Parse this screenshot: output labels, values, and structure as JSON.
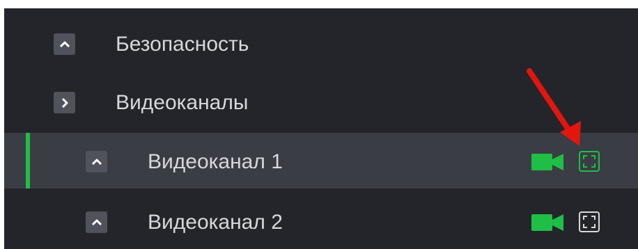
{
  "tree": {
    "items": [
      {
        "label": "Безопасность",
        "toggle_icon": "chevron-up-icon"
      },
      {
        "label": "Видеоканалы",
        "toggle_icon": "chevron-right-icon"
      },
      {
        "label": "Видеоканал 1",
        "toggle_icon": "chevron-up-icon",
        "selected": true,
        "camera_icon": "video-camera-icon",
        "expand_icon": "fullscreen-icon"
      },
      {
        "label": "Видеоканал 2",
        "toggle_icon": "chevron-up-icon",
        "selected": false,
        "camera_icon": "video-camera-icon",
        "expand_icon": "fullscreen-icon"
      }
    ]
  },
  "colors": {
    "panel_background": "#23252b",
    "selected_row": "#3a3d44",
    "accent_green": "#1fbf45",
    "text": "#d7d8da",
    "annotation_arrow": "#e3160f"
  }
}
